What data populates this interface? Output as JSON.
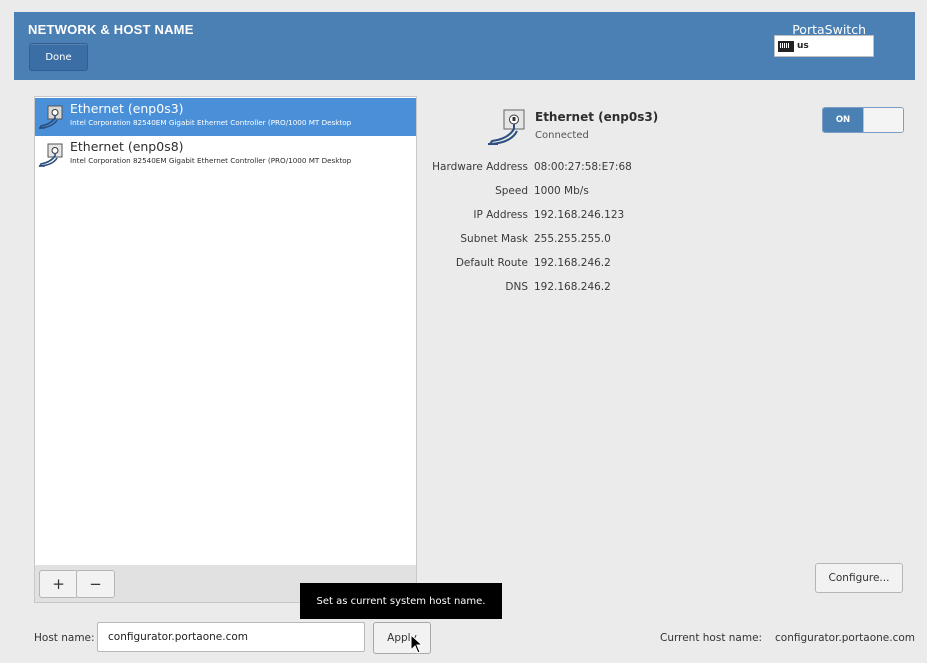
{
  "header": {
    "title": "NETWORK & HOST NAME",
    "done_label": "Done",
    "product": "PortaSwitch",
    "keyboard_layout": "us"
  },
  "colors": {
    "header_blue": "#4a80b4",
    "selection_blue": "#4a90d9",
    "tooltip_bg": "#000000"
  },
  "devices": [
    {
      "name": "Ethernet (enp0s3)",
      "description": "Intel Corporation 82540EM Gigabit Ethernet Controller (PRO/1000 MT Desktop",
      "selected": true,
      "icon": "ethernet-icon"
    },
    {
      "name": "Ethernet (enp0s8)",
      "description": "Intel Corporation 82540EM Gigabit Ethernet Controller (PRO/1000 MT Desktop",
      "selected": false,
      "icon": "ethernet-icon"
    }
  ],
  "list_toolbar": {
    "add_label": "+",
    "remove_label": "−"
  },
  "detail": {
    "name": "Ethernet (enp0s3)",
    "status": "Connected",
    "toggle_label": "ON",
    "rows": [
      {
        "label": "Hardware Address",
        "value": "08:00:27:58:E7:68"
      },
      {
        "label": "Speed",
        "value": "1000 Mb/s"
      },
      {
        "label": "IP Address",
        "value": "192.168.246.123"
      },
      {
        "label": "Subnet Mask",
        "value": "255.255.255.0"
      },
      {
        "label": "Default Route",
        "value": "192.168.246.2"
      },
      {
        "label": "DNS",
        "value": "192.168.246.2"
      }
    ],
    "configure_label": "Configure..."
  },
  "tooltip": "Set as current system host name.",
  "hostname": {
    "label": "Host name:",
    "value": "configurator.portaone.com",
    "apply_label": "Apply",
    "current_label": "Current host name:",
    "current_value": "configurator.portaone.com"
  }
}
